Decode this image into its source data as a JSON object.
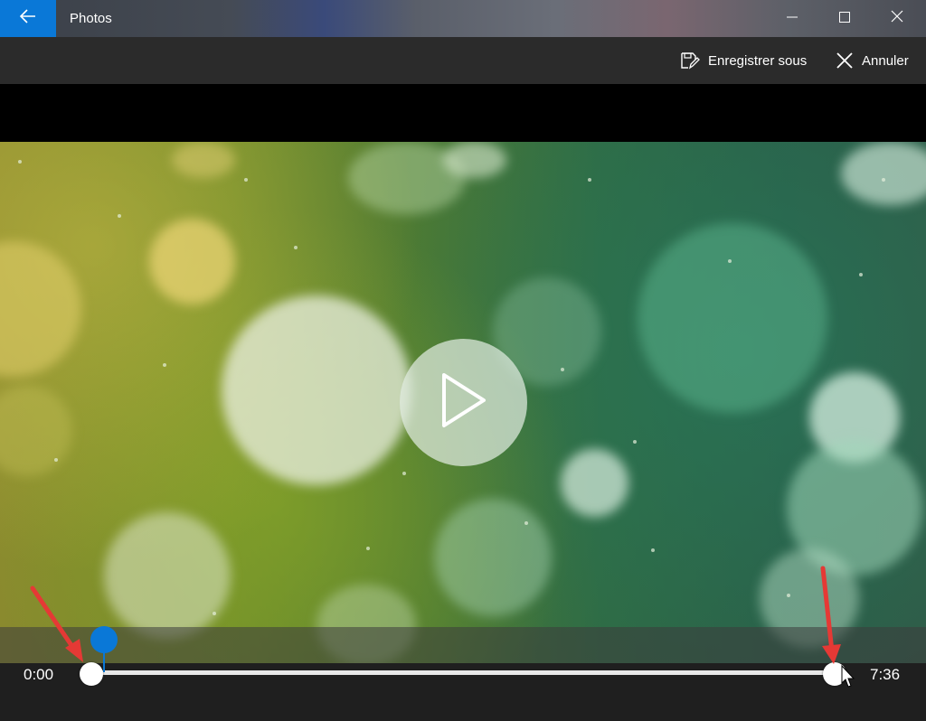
{
  "window": {
    "title": "Photos",
    "back_icon": "arrow-left-icon",
    "minimize_icon": "minimize-icon",
    "maximize_icon": "maximize-icon",
    "close_icon": "close-icon",
    "accent_color": "#0a78d7"
  },
  "command_bar": {
    "save_as_label": "Enregistrer sous",
    "save_as_icon": "save-as-icon",
    "cancel_label": "Annuler",
    "cancel_icon": "close-icon",
    "background_color": "#2b2b2b"
  },
  "player": {
    "play_icon": "play-icon",
    "start_time": "0:00",
    "end_time": "7:36",
    "trim_start_fraction": 0.0,
    "trim_end_fraction": 1.0,
    "playhead_fraction": 0.0,
    "playhead_color": "#0a78d7"
  },
  "annotations": {
    "arrow_color": "#e53935",
    "arrow_icon": "red-arrow-icon"
  }
}
